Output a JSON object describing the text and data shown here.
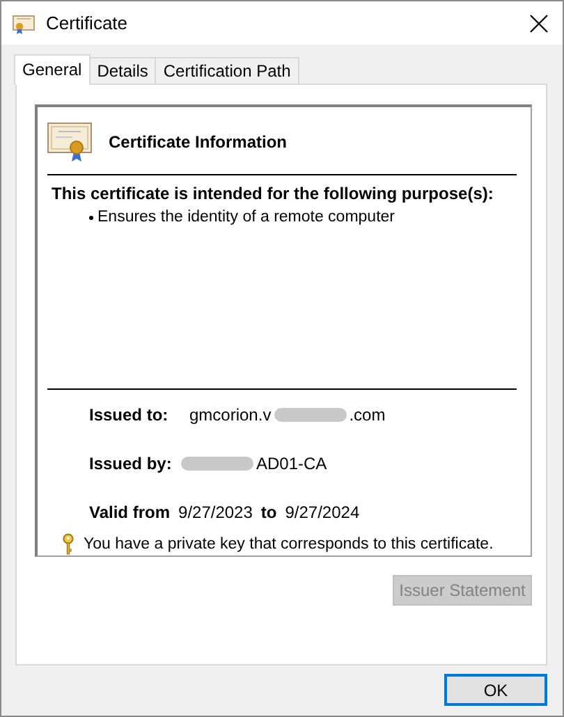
{
  "window": {
    "title": "Certificate"
  },
  "tabs": [
    {
      "label": "General",
      "selected": true
    },
    {
      "label": "Details",
      "selected": false
    },
    {
      "label": "Certification Path",
      "selected": false
    }
  ],
  "info": {
    "heading": "Certificate Information",
    "purpose_title": "This certificate is intended for the following purpose(s):",
    "purposes": [
      "Ensures the identity of a remote computer"
    ]
  },
  "fields": [
    {
      "label": "Issued to:",
      "value": [
        {
          "kind": "text",
          "text": "gmcorion.v"
        },
        {
          "kind": "redacted"
        },
        {
          "kind": "text",
          "text": ".com"
        }
      ]
    },
    {
      "label": "Issued by:",
      "value": [
        {
          "kind": "redacted"
        },
        {
          "kind": "text",
          "text": "AD01-CA"
        }
      ]
    }
  ],
  "validity": {
    "from_label": "Valid from",
    "from": "9/27/2023",
    "to_label": "to",
    "to": "9/27/2024"
  },
  "private_key_note": "You have a private key that corresponds to this certificate.",
  "issuer_button": {
    "label": "Issuer Statement",
    "disabled": true
  },
  "ok_button": {
    "label": "OK",
    "focused": true
  }
}
